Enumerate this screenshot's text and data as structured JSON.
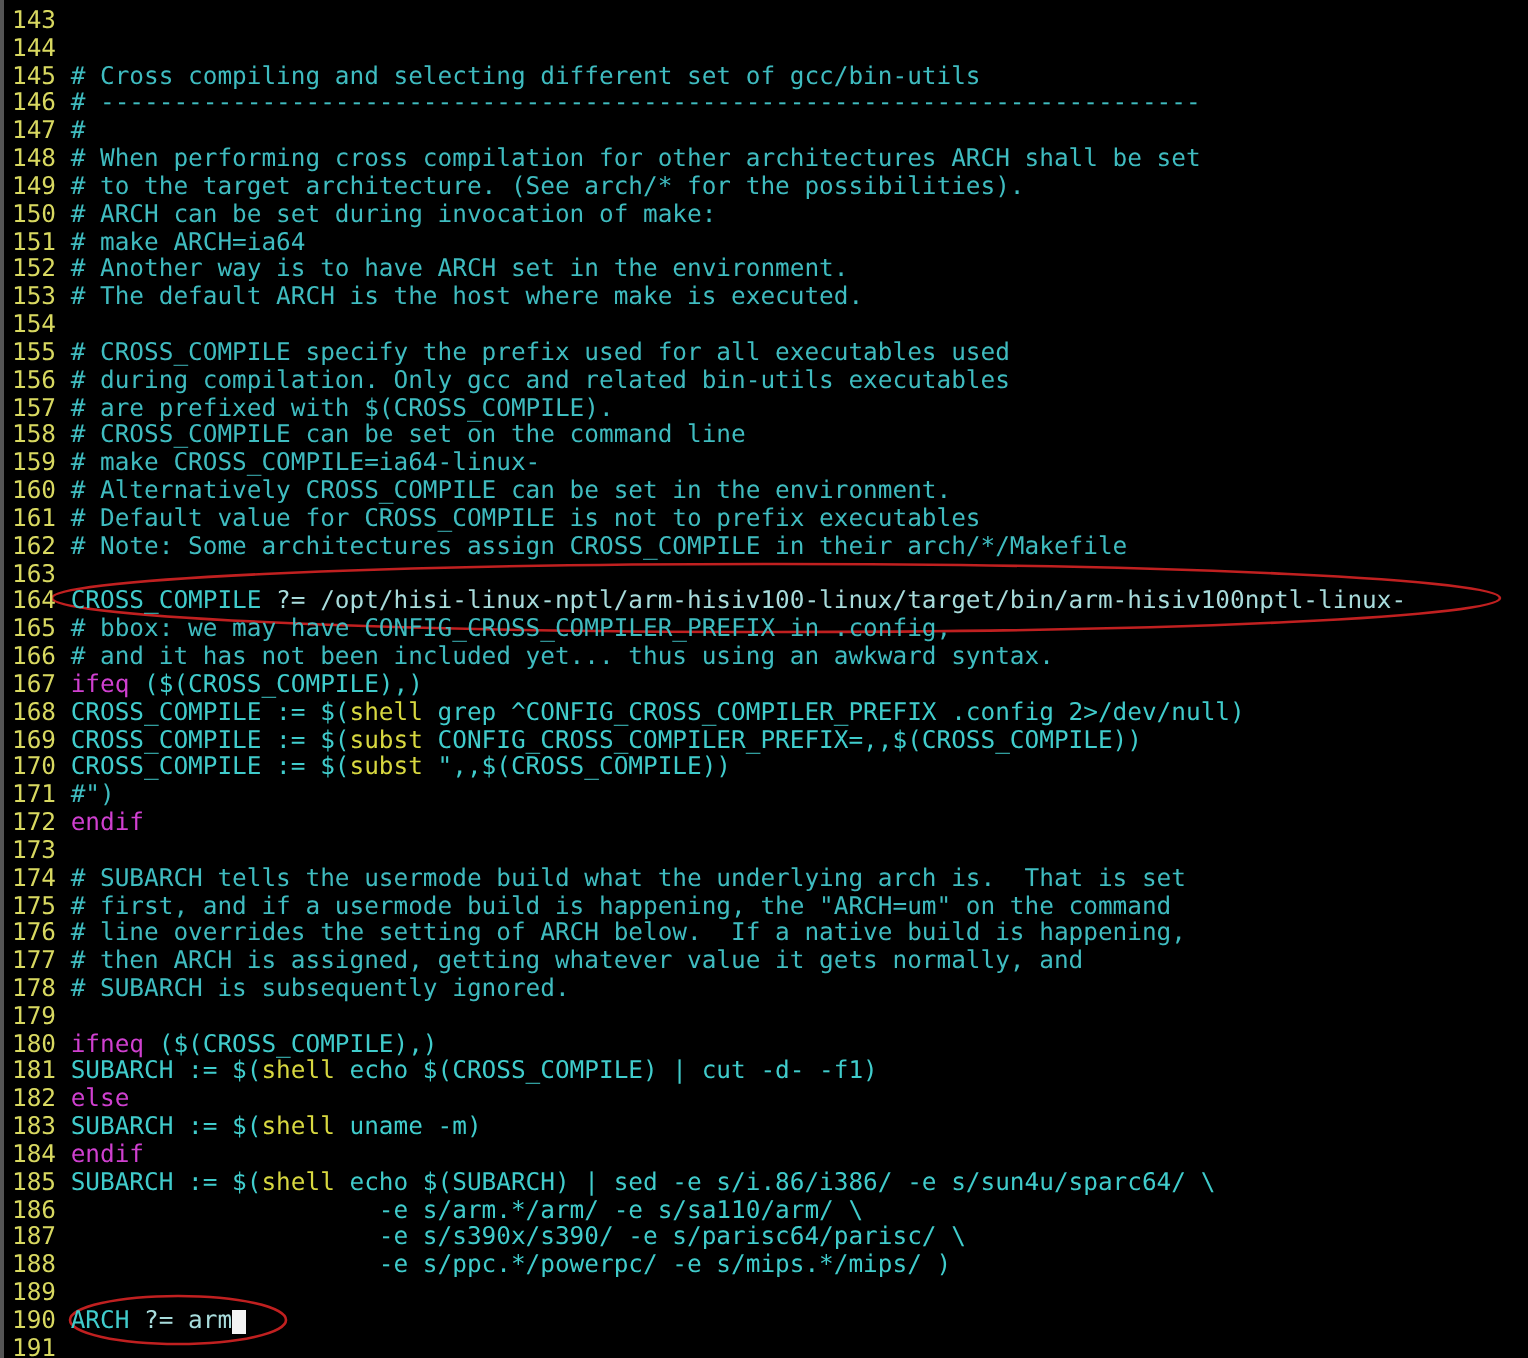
{
  "editor": {
    "lines": [
      {
        "number": "143",
        "cursor": false
      },
      {
        "number": "144",
        "cursor": false
      },
      {
        "number": "145",
        "cursor": false,
        "segments": [
          {
            "kind": "comment",
            "text": "# Cross compiling and selecting different set of gcc/bin-utils"
          }
        ]
      },
      {
        "number": "146",
        "cursor": false,
        "segments": [
          {
            "kind": "comment",
            "text": "# ---------------------------------------------------------------------------"
          }
        ]
      },
      {
        "number": "147",
        "cursor": false,
        "segments": [
          {
            "kind": "comment",
            "text": "#"
          }
        ]
      },
      {
        "number": "148",
        "cursor": false,
        "segments": [
          {
            "kind": "comment",
            "text": "# When performing cross compilation for other architectures ARCH shall be set"
          }
        ]
      },
      {
        "number": "149",
        "cursor": false,
        "segments": [
          {
            "kind": "comment",
            "text": "# to the target architecture. (See arch/* for the possibilities)."
          }
        ]
      },
      {
        "number": "150",
        "cursor": false,
        "segments": [
          {
            "kind": "comment",
            "text": "# ARCH can be set during invocation of make:"
          }
        ]
      },
      {
        "number": "151",
        "cursor": false,
        "segments": [
          {
            "kind": "comment",
            "text": "# make ARCH=ia64"
          }
        ]
      },
      {
        "number": "152",
        "cursor": false,
        "segments": [
          {
            "kind": "comment",
            "text": "# Another way is to have ARCH set in the environment."
          }
        ]
      },
      {
        "number": "153",
        "cursor": false,
        "segments": [
          {
            "kind": "comment",
            "text": "# The default ARCH is the host where make is executed."
          }
        ]
      },
      {
        "number": "154",
        "cursor": false
      },
      {
        "number": "155",
        "cursor": false,
        "segments": [
          {
            "kind": "comment",
            "text": "# CROSS_COMPILE specify the prefix used for all executables used"
          }
        ]
      },
      {
        "number": "156",
        "cursor": false,
        "segments": [
          {
            "kind": "comment",
            "text": "# during compilation. Only gcc and related bin-utils executables"
          }
        ]
      },
      {
        "number": "157",
        "cursor": false,
        "segments": [
          {
            "kind": "comment",
            "text": "# are prefixed with $(CROSS_COMPILE)."
          }
        ]
      },
      {
        "number": "158",
        "cursor": false,
        "segments": [
          {
            "kind": "comment",
            "text": "# CROSS_COMPILE can be set on the command line"
          }
        ]
      },
      {
        "number": "159",
        "cursor": false,
        "segments": [
          {
            "kind": "comment",
            "text": "# make CROSS_COMPILE=ia64-linux-"
          }
        ]
      },
      {
        "number": "160",
        "cursor": false,
        "segments": [
          {
            "kind": "comment",
            "text": "# Alternatively CROSS_COMPILE can be set in the environment."
          }
        ]
      },
      {
        "number": "161",
        "cursor": false,
        "segments": [
          {
            "kind": "comment",
            "text": "# Default value for CROSS_COMPILE is not to prefix executables"
          }
        ]
      },
      {
        "number": "162",
        "cursor": false,
        "segments": [
          {
            "kind": "comment",
            "text": "# Note: Some architectures assign CROSS_COMPILE in their arch/*/Makefile"
          }
        ]
      },
      {
        "number": "163",
        "cursor": false
      },
      {
        "number": "164",
        "cursor": false,
        "segments": [
          {
            "kind": "code",
            "text": "CROSS_COMPILE"
          },
          {
            "kind": "value",
            "text": " ?= /opt/hisi-linux-nptl/arm-hisiv100-linux/target/bin/arm-hisiv100nptl-linux-"
          }
        ]
      },
      {
        "number": "165",
        "cursor": false,
        "segments": [
          {
            "kind": "comment",
            "text": "# bbox: we may have CONFIG_CROSS_COMPILER_PREFIX in .config,"
          }
        ]
      },
      {
        "number": "166",
        "cursor": false,
        "segments": [
          {
            "kind": "comment",
            "text": "# and it has not been included yet... thus using an awkward syntax."
          }
        ]
      },
      {
        "number": "167",
        "cursor": false,
        "segments": [
          {
            "kind": "keyword",
            "text": "ifeq"
          },
          {
            "kind": "code",
            "text": " ($(CROSS_COMPILE),)"
          }
        ]
      },
      {
        "number": "168",
        "cursor": false,
        "segments": [
          {
            "kind": "code",
            "text": "CROSS_COMPILE := $("
          },
          {
            "kind": "func",
            "text": "shell"
          },
          {
            "kind": "code",
            "text": " grep ^CONFIG_CROSS_COMPILER_PREFIX .config 2>/dev/null)"
          }
        ]
      },
      {
        "number": "169",
        "cursor": false,
        "segments": [
          {
            "kind": "code",
            "text": "CROSS_COMPILE := $("
          },
          {
            "kind": "func",
            "text": "subst"
          },
          {
            "kind": "code",
            "text": " CONFIG_CROSS_COMPILER_PREFIX=,,$(CROSS_COMPILE))"
          }
        ]
      },
      {
        "number": "170",
        "cursor": false,
        "segments": [
          {
            "kind": "code",
            "text": "CROSS_COMPILE := $("
          },
          {
            "kind": "func",
            "text": "subst"
          },
          {
            "kind": "code",
            "text": " \",,$(CROSS_COMPILE))"
          }
        ]
      },
      {
        "number": "171",
        "cursor": false,
        "segments": [
          {
            "kind": "comment",
            "text": "#\")"
          }
        ]
      },
      {
        "number": "172",
        "cursor": false,
        "segments": [
          {
            "kind": "keyword",
            "text": "endif"
          }
        ]
      },
      {
        "number": "173",
        "cursor": false
      },
      {
        "number": "174",
        "cursor": false,
        "segments": [
          {
            "kind": "comment",
            "text": "# SUBARCH tells the usermode build what the underlying arch is.  That is set"
          }
        ]
      },
      {
        "number": "175",
        "cursor": false,
        "segments": [
          {
            "kind": "comment",
            "text": "# first, and if a usermode build is happening, the \"ARCH=um\" on the command"
          }
        ]
      },
      {
        "number": "176",
        "cursor": false,
        "segments": [
          {
            "kind": "comment",
            "text": "# line overrides the setting of ARCH below.  If a native build is happening,"
          }
        ]
      },
      {
        "number": "177",
        "cursor": false,
        "segments": [
          {
            "kind": "comment",
            "text": "# then ARCH is assigned, getting whatever value it gets normally, and"
          }
        ]
      },
      {
        "number": "178",
        "cursor": false,
        "segments": [
          {
            "kind": "comment",
            "text": "# SUBARCH is subsequently ignored."
          }
        ]
      },
      {
        "number": "179",
        "cursor": false
      },
      {
        "number": "180",
        "cursor": false,
        "segments": [
          {
            "kind": "keyword",
            "text": "ifneq"
          },
          {
            "kind": "code",
            "text": " ($(CROSS_COMPILE),)"
          }
        ]
      },
      {
        "number": "181",
        "cursor": false,
        "segments": [
          {
            "kind": "code",
            "text": "SUBARCH := $("
          },
          {
            "kind": "func",
            "text": "shell"
          },
          {
            "kind": "code",
            "text": " echo $(CROSS_COMPILE) | cut -d- -f1)"
          }
        ]
      },
      {
        "number": "182",
        "cursor": false,
        "segments": [
          {
            "kind": "keyword",
            "text": "else"
          }
        ]
      },
      {
        "number": "183",
        "cursor": false,
        "segments": [
          {
            "kind": "code",
            "text": "SUBARCH := $("
          },
          {
            "kind": "func",
            "text": "shell"
          },
          {
            "kind": "code",
            "text": " uname -m)"
          }
        ]
      },
      {
        "number": "184",
        "cursor": false,
        "segments": [
          {
            "kind": "keyword",
            "text": "endif"
          }
        ]
      },
      {
        "number": "185",
        "cursor": false,
        "segments": [
          {
            "kind": "code",
            "text": "SUBARCH := $("
          },
          {
            "kind": "func",
            "text": "shell"
          },
          {
            "kind": "code",
            "text": " echo $(SUBARCH) | sed -e s/i.86/i386/ -e s/sun4u/sparc64/ \\"
          }
        ]
      },
      {
        "number": "186",
        "cursor": false,
        "segments": [
          {
            "kind": "code",
            "text": "                     -e s/arm.*/arm/ -e s/sa110/arm/ \\"
          }
        ]
      },
      {
        "number": "187",
        "cursor": false,
        "segments": [
          {
            "kind": "code",
            "text": "                     -e s/s390x/s390/ -e s/parisc64/parisc/ \\"
          }
        ]
      },
      {
        "number": "188",
        "cursor": false,
        "segments": [
          {
            "kind": "code",
            "text": "                     -e s/ppc.*/powerpc/ -e s/mips.*/mips/ )"
          }
        ]
      },
      {
        "number": "189",
        "cursor": false
      },
      {
        "number": "190",
        "cursor": true,
        "segments": [
          {
            "kind": "code",
            "text": "ARCH"
          },
          {
            "kind": "value",
            "text": " ?= arm"
          }
        ]
      },
      {
        "number": "191",
        "cursor": false
      }
    ]
  }
}
